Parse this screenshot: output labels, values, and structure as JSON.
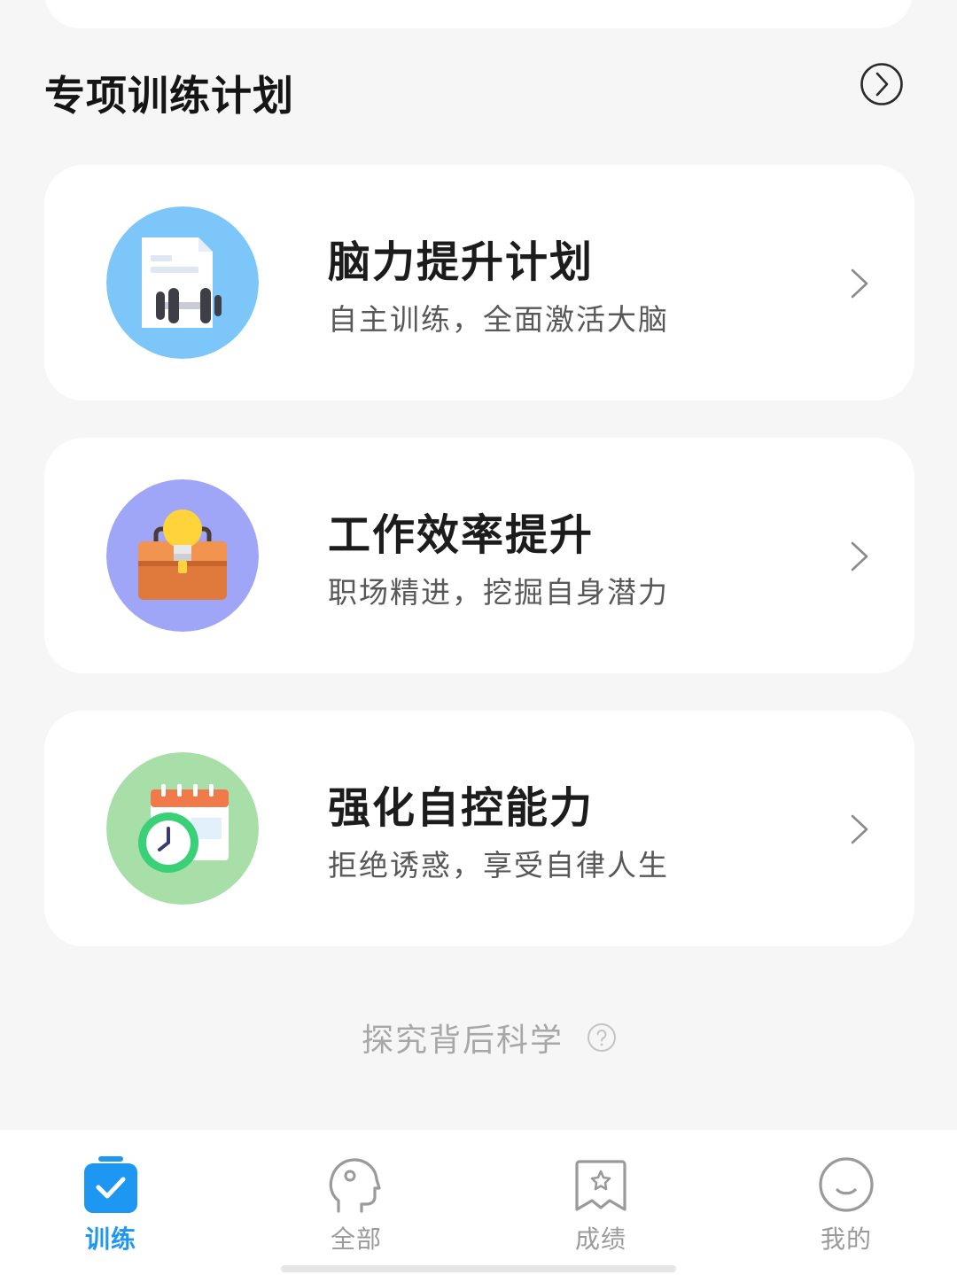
{
  "section": {
    "title": "专项训练计划"
  },
  "plans": [
    {
      "title": "脑力提升计划",
      "subtitle": "自主训练，全面激活大脑",
      "icon": "document-dumbbell-icon",
      "circle_color": "#7cc6f9"
    },
    {
      "title": "工作效率提升",
      "subtitle": "职场精进，挖掘自身潜力",
      "icon": "briefcase-lightbulb-icon",
      "circle_color": "#a0a6f7"
    },
    {
      "title": "强化自控能力",
      "subtitle": "拒绝诱惑，享受自律人生",
      "icon": "calendar-clock-icon",
      "circle_color": "#a8dfa9"
    }
  ],
  "science": {
    "label": "探究背后科学"
  },
  "tabs": [
    {
      "label": "训练",
      "icon": "checkbox-clipboard-icon",
      "active": true
    },
    {
      "label": "全部",
      "icon": "head-profile-icon",
      "active": false
    },
    {
      "label": "成绩",
      "icon": "star-badge-icon",
      "active": false
    },
    {
      "label": "我的",
      "icon": "smiley-face-icon",
      "active": false
    }
  ],
  "colors": {
    "accent": "#1d97f2",
    "background": "#f6f6f6",
    "card": "#ffffff"
  }
}
